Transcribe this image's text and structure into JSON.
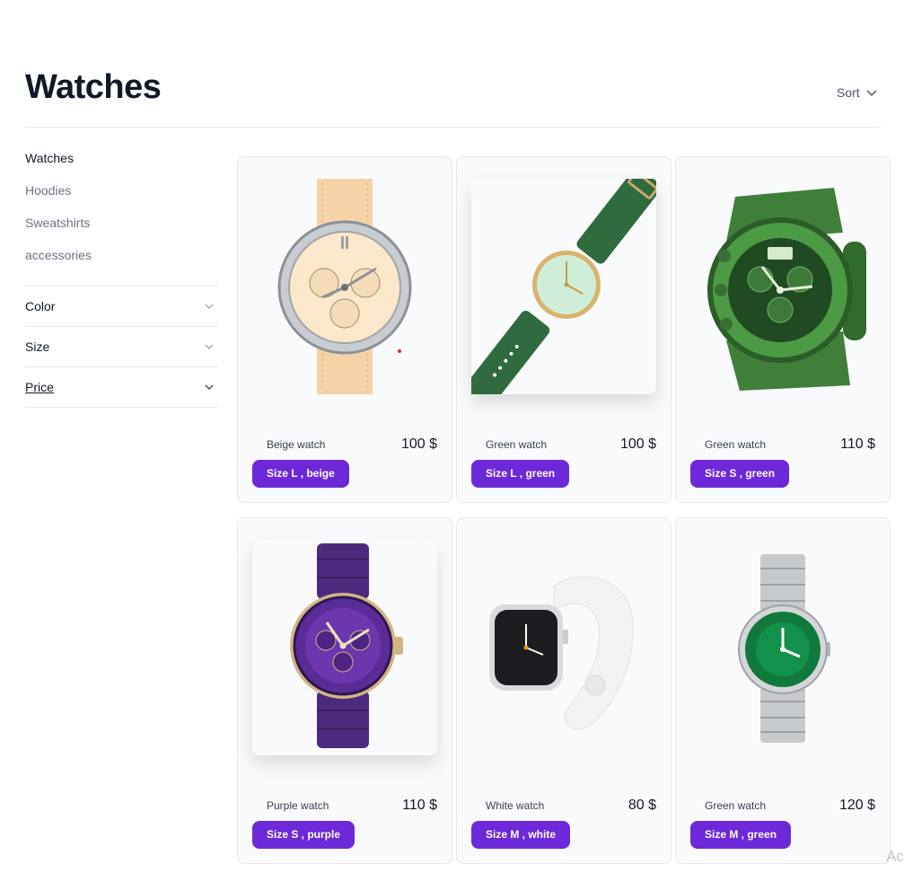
{
  "page": {
    "title": "Watches"
  },
  "sort": {
    "label": "Sort",
    "icon": "chevron-down-icon"
  },
  "sidebar": {
    "categories": [
      {
        "label": "Watches",
        "active": true
      },
      {
        "label": "Hoodies",
        "active": false
      },
      {
        "label": "Sweatshirts",
        "active": false
      },
      {
        "label": "accessories",
        "active": false
      }
    ],
    "filters": [
      {
        "label": "Color"
      },
      {
        "label": "Size"
      },
      {
        "label": "Price"
      }
    ]
  },
  "products": [
    {
      "name": "Beige watch",
      "price": "100 $",
      "tag": "Size L , beige"
    },
    {
      "name": "Green watch",
      "price": "100 $",
      "tag": "Size L , green"
    },
    {
      "name": "Green watch",
      "price": "110 $",
      "tag": "Size S , green"
    },
    {
      "name": "Purple watch",
      "price": "110 $",
      "tag": "Size S , purple"
    },
    {
      "name": "White watch",
      "price": "80 $",
      "tag": "Size M , white"
    },
    {
      "name": "Green watch",
      "price": "120 $",
      "tag": "Size M , green"
    }
  ],
  "watermark": "Ac",
  "colors": {
    "accent": "#6d28d9",
    "card_bg": "#f9fafb",
    "border": "#e5e7eb",
    "heading": "#111827",
    "muted": "#6b7280"
  }
}
